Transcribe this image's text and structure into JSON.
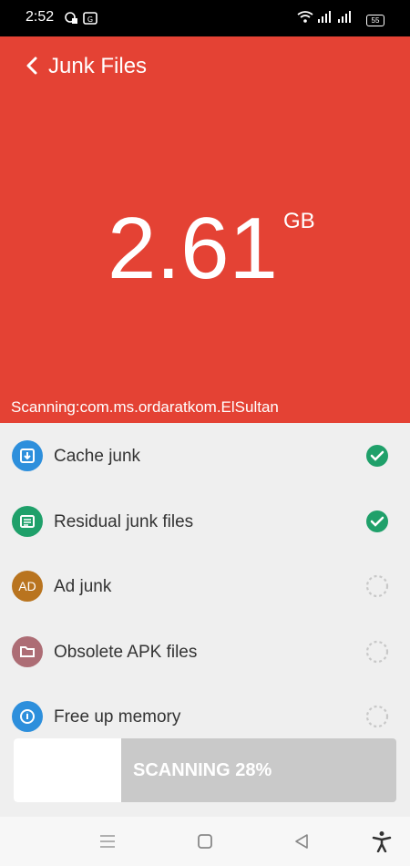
{
  "status_bar": {
    "time": "2:52",
    "battery": "55"
  },
  "header": {
    "title": "Junk Files",
    "size_value": "2.61",
    "size_unit": "GB",
    "scanning_text": "Scanning:com.ms.ordaratkom.ElSultan",
    "bg_color": "#e44234"
  },
  "items": [
    {
      "label": "Cache junk",
      "icon": "download-box-icon",
      "icon_color": "#2d8fdc",
      "status": "done"
    },
    {
      "label": "Residual junk files",
      "icon": "document-icon",
      "icon_color": "#1fa06a",
      "status": "done"
    },
    {
      "label": "Ad junk",
      "icon_text": "AD",
      "icon": "ad-icon",
      "icon_color": "#b9741f",
      "status": "loading"
    },
    {
      "label": "Obsolete APK files",
      "icon": "folder-icon",
      "icon_color": "#ad6d75",
      "status": "loading"
    },
    {
      "label": "Free up memory",
      "icon": "memory-icon",
      "icon_color": "#2d8fdc",
      "status": "loading"
    }
  ],
  "progress": {
    "label": "SCANNING 28%",
    "percent": 28
  },
  "nav": {
    "icons": [
      "menu-icon",
      "home-square-icon",
      "back-triangle-icon",
      "accessibility-icon"
    ]
  }
}
